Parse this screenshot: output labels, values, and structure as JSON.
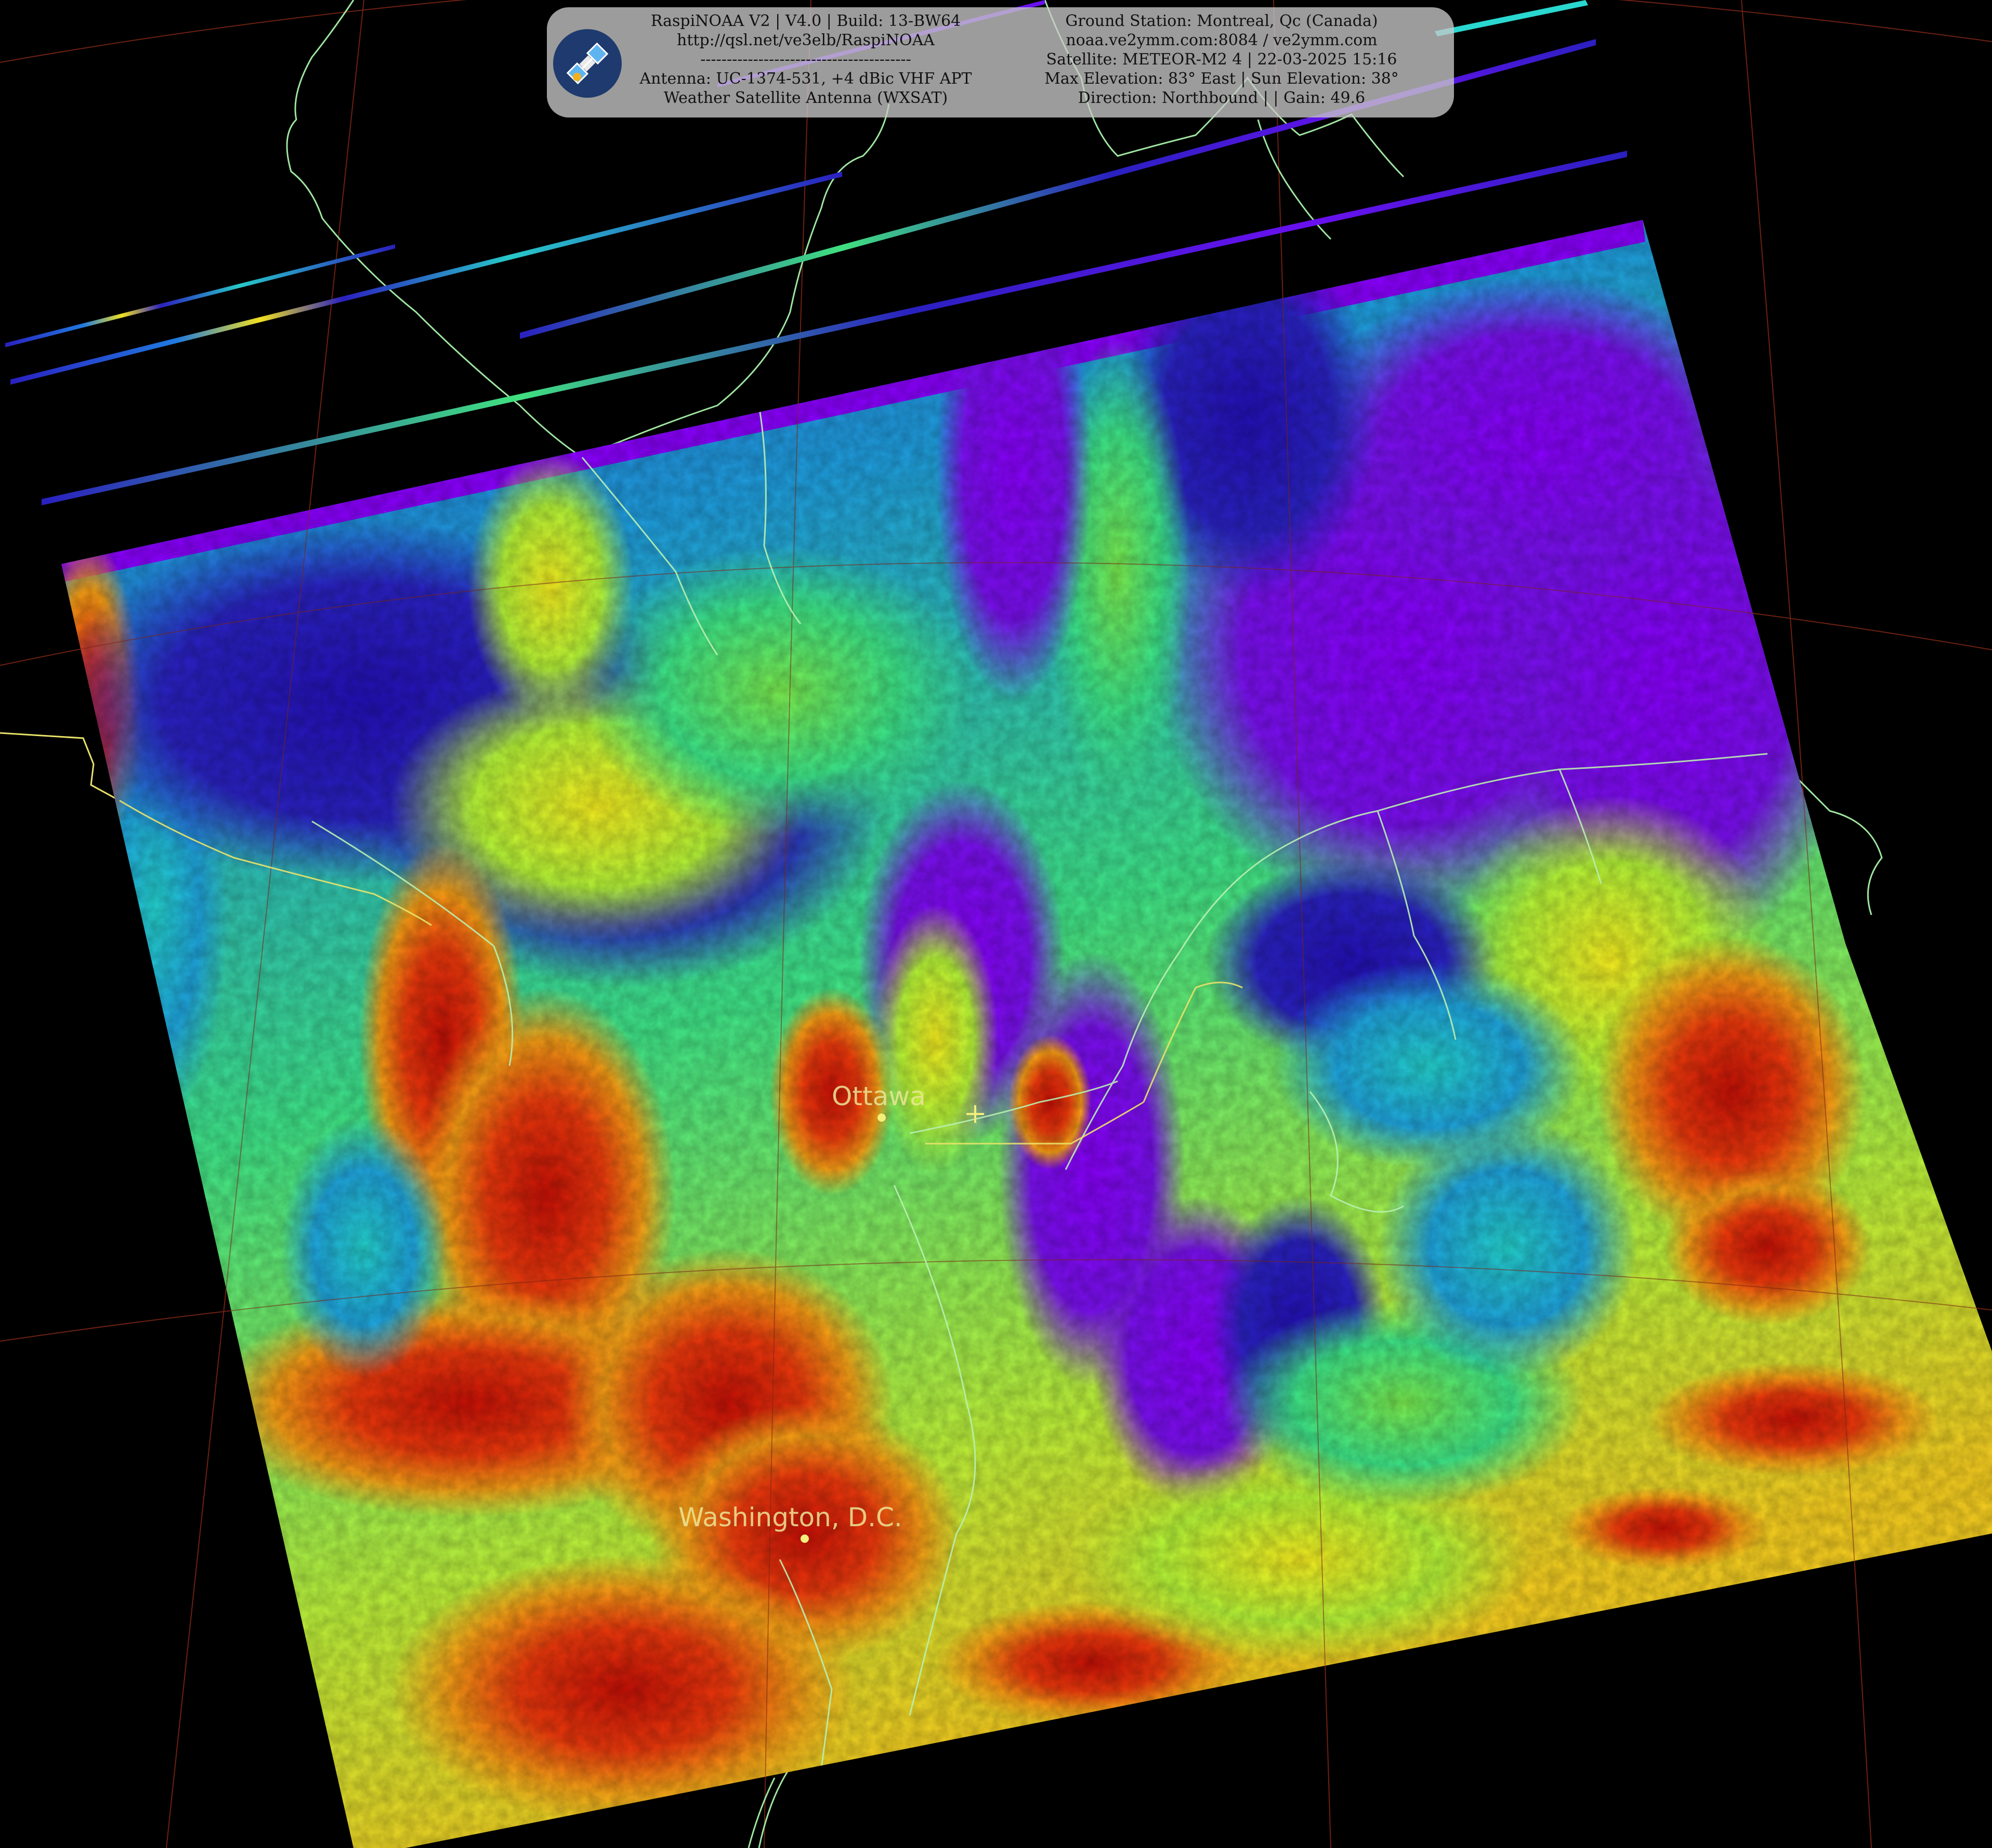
{
  "header": {
    "left_lines": [
      "RaspiNOAA V2 | V4.0 | Build: 13-BW64",
      "http://qsl.net/ve3elb/RaspiNOAA",
      "----------------------------------------",
      "Antenna: UC-1374-531, +4 dBic VHF APT",
      "Weather Satellite Antenna (WXSAT)"
    ],
    "right_lines": [
      "Ground Station: Montreal, Qc (Canada)",
      "noaa.ve2ymm.com:8084 / ve2ymm.com",
      "Satellite: METEOR-M2 4 | 22-03-2025 15:16",
      "Max Elevation: 83° East | Sun Elevation: 38°",
      "Direction: Northbound | | Gain: 49.6"
    ]
  },
  "cities": [
    {
      "name": "Ottawa"
    },
    {
      "name": "Washington, D.C."
    }
  ],
  "icons": {
    "logo": "satellite-icon",
    "station": "crosshair-icon"
  },
  "colors": {
    "background": "#000000",
    "coastline": "#9fe6a0",
    "graticule": "#8b2a1a",
    "border": "#e9e36a",
    "palette": [
      "#7a00ff",
      "#8a10f0",
      "#2a10c8",
      "#1a4ad8",
      "#1f9fe0",
      "#22d8c0",
      "#40f07a",
      "#b0f838",
      "#f8f020",
      "#f89818",
      "#e83010",
      "#b01008"
    ]
  }
}
